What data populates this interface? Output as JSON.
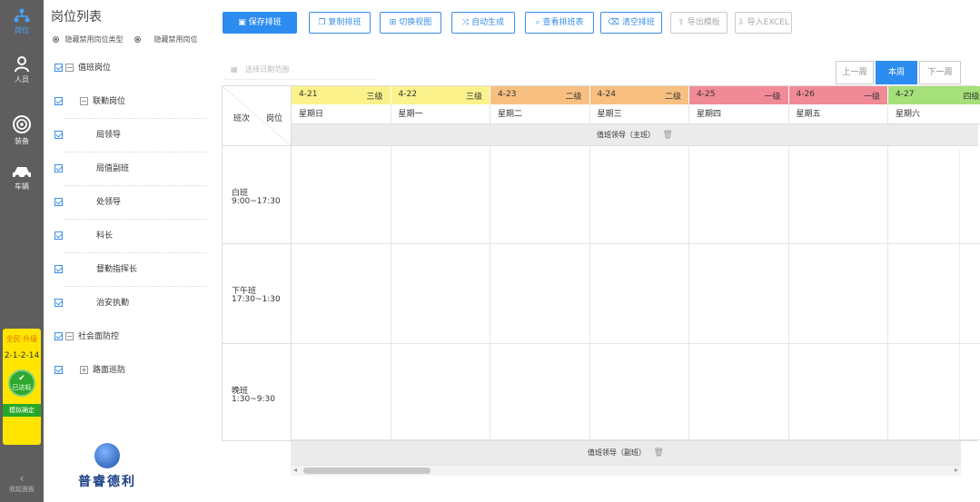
{
  "rail": {
    "top_label": "岗位",
    "person_label": "人员",
    "equip_label": "装备",
    "vehicle_label": "车辆",
    "status_title": "全民·升级",
    "status_value": "2-1-2-14",
    "status_badge": "已达标",
    "status_foot": "模拟确定",
    "collapse_label": "收起面板"
  },
  "poslist": {
    "title": "岗位列表",
    "radio1": "隐藏禁用岗位类型",
    "radio2": "隐藏禁用岗位",
    "items": [
      {
        "label": "值班岗位"
      },
      {
        "label": "联勤岗位"
      },
      {
        "label": "局领导"
      },
      {
        "label": "局值副班"
      },
      {
        "label": "处领导"
      },
      {
        "label": "科长"
      },
      {
        "label": "督勤指挥长"
      },
      {
        "label": "治安执勤"
      },
      {
        "label": "社会面防控"
      },
      {
        "label": "路面巡防"
      }
    ]
  },
  "toolbar": {
    "save": "保存排班",
    "copy": "复制排班",
    "switch_view": "切换视图",
    "auto": "自动生成",
    "view_table": "查看排班表",
    "clear": "清空排班",
    "export": "导出模板",
    "import": "导入EXCEL"
  },
  "date_picker": {
    "placeholder": "选择日期范围"
  },
  "week_nav": {
    "prev": "上一周",
    "current": "本周",
    "next": "下一周"
  },
  "grid": {
    "corner_shift": "班次",
    "corner_post": "岗位",
    "days": [
      {
        "date": "4-21",
        "level": "三级",
        "name": "星期日",
        "color": "#fbf28c"
      },
      {
        "date": "4-22",
        "level": "三级",
        "name": "星期一",
        "color": "#fbf28c"
      },
      {
        "date": "4-23",
        "level": "二级",
        "name": "星期二",
        "color": "#f8c080"
      },
      {
        "date": "4-24",
        "level": "二级",
        "name": "星期三",
        "color": "#f8c080"
      },
      {
        "date": "4-25",
        "level": "一级",
        "name": "星期四",
        "color": "#f08a96"
      },
      {
        "date": "4-26",
        "level": "一级",
        "name": "星期五",
        "color": "#f08a96"
      },
      {
        "date": "4-27",
        "level": "四级",
        "name": "星期六",
        "color": "#a6e07a"
      }
    ],
    "lead_row": "值班领导（主班）",
    "shifts": [
      {
        "name": "白班",
        "time": "9:00~17:30"
      },
      {
        "name": "下午班",
        "time": "17:30~1:30"
      },
      {
        "name": "晚班",
        "time": "1:30~9:30"
      }
    ],
    "deputy_row": "值班领导（副班）"
  },
  "logo": {
    "text": "普睿德利"
  }
}
